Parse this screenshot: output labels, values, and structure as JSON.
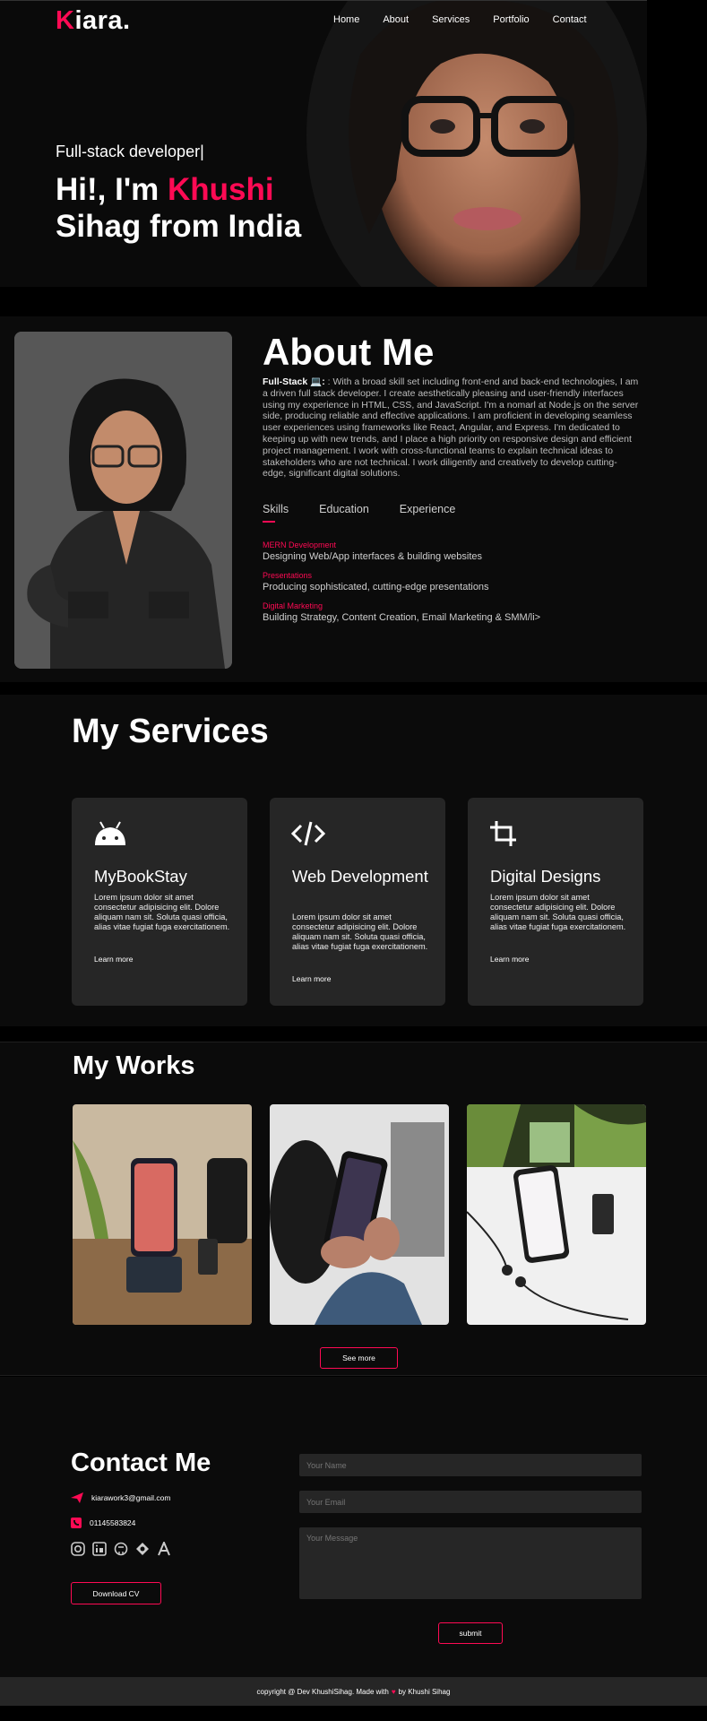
{
  "brand": {
    "logo_first": "K",
    "logo_rest": "iara.",
    "accent": "#ff0a54"
  },
  "nav": {
    "items": [
      "Home",
      "About",
      "Services",
      "Portfolio",
      "Contact"
    ]
  },
  "hero": {
    "subtitle": "Full-stack developer|",
    "greeting": "Hi!, I'm ",
    "name": "Khushi",
    "line2": "Sihag from India"
  },
  "about": {
    "title": "About Me",
    "lead": "Full-Stack",
    "lead_suffix": ": With a broad skill set including front-end and back-end technologies, I am a driven full stack developer. I create aesthetically pleasing and user-friendly interfaces using my experience in HTML, CSS, and JavaScript. I'm a nomarl at Node.js on the server side, producing reliable and effective applications. I am proficient in developing seamless user experiences using frameworks like React, Angular, and Express. I'm dedicated to keeping up with new trends, and I place a high priority on responsive design and efficient project management. I work with cross-functional teams to explain technical ideas to stakeholders who are not technical. I work diligently and creatively to develop cutting-edge, significant digital solutions.",
    "tabs": [
      "Skills",
      "Education",
      "Experience"
    ],
    "skills": [
      {
        "title": "MERN Development",
        "desc": "Designing Web/App interfaces & building websites"
      },
      {
        "title": "Presentations",
        "desc": "Producing sophisticated, cutting-edge presentations"
      },
      {
        "title": "Digital Marketing",
        "desc": "Building Strategy, Content Creation, Email Marketing & SMM/li>"
      }
    ]
  },
  "services": {
    "title": "My Services",
    "cards": [
      {
        "icon": "android-icon",
        "title": "MyBookStay",
        "text": "Lorem ipsum dolor sit amet consectetur adipisicing elit. Dolore aliquam nam sit. Soluta quasi officia, alias vitae fugiat fuga exercitationem.",
        "link": "Learn more"
      },
      {
        "icon": "code-icon",
        "title": "Web Development",
        "text": "Lorem ipsum dolor sit amet consectetur adipisicing elit. Dolore aliquam nam sit. Soluta quasi officia, alias vitae fugiat fuga exercitationem.",
        "link": "Learn more"
      },
      {
        "icon": "crop-icon",
        "title": "Digital Designs",
        "text": "Lorem ipsum dolor sit amet consectetur adipisicing elit. Dolore aliquam nam sit. Soluta quasi officia, alias vitae fugiat fuga exercitationem.",
        "link": "Learn more"
      }
    ]
  },
  "works": {
    "title": "My Works",
    "see_more": "See more"
  },
  "contact": {
    "title": "Contact Me",
    "email": "kiarawork3@gmail.com",
    "phone": "01145583824",
    "socials": [
      "instagram-icon",
      "linkedin-icon",
      "github-icon",
      "hashnode-icon",
      "font-icon"
    ],
    "download_cv": "Download CV",
    "name_placeholder": "Your Name",
    "email_placeholder": "Your Email",
    "message_placeholder": "Your Message",
    "submit": "submit"
  },
  "footer": {
    "before": "copyright @ Dev KhushiSihag. Made with",
    "heart": "♥",
    "after": "by Khushi Sihag"
  }
}
